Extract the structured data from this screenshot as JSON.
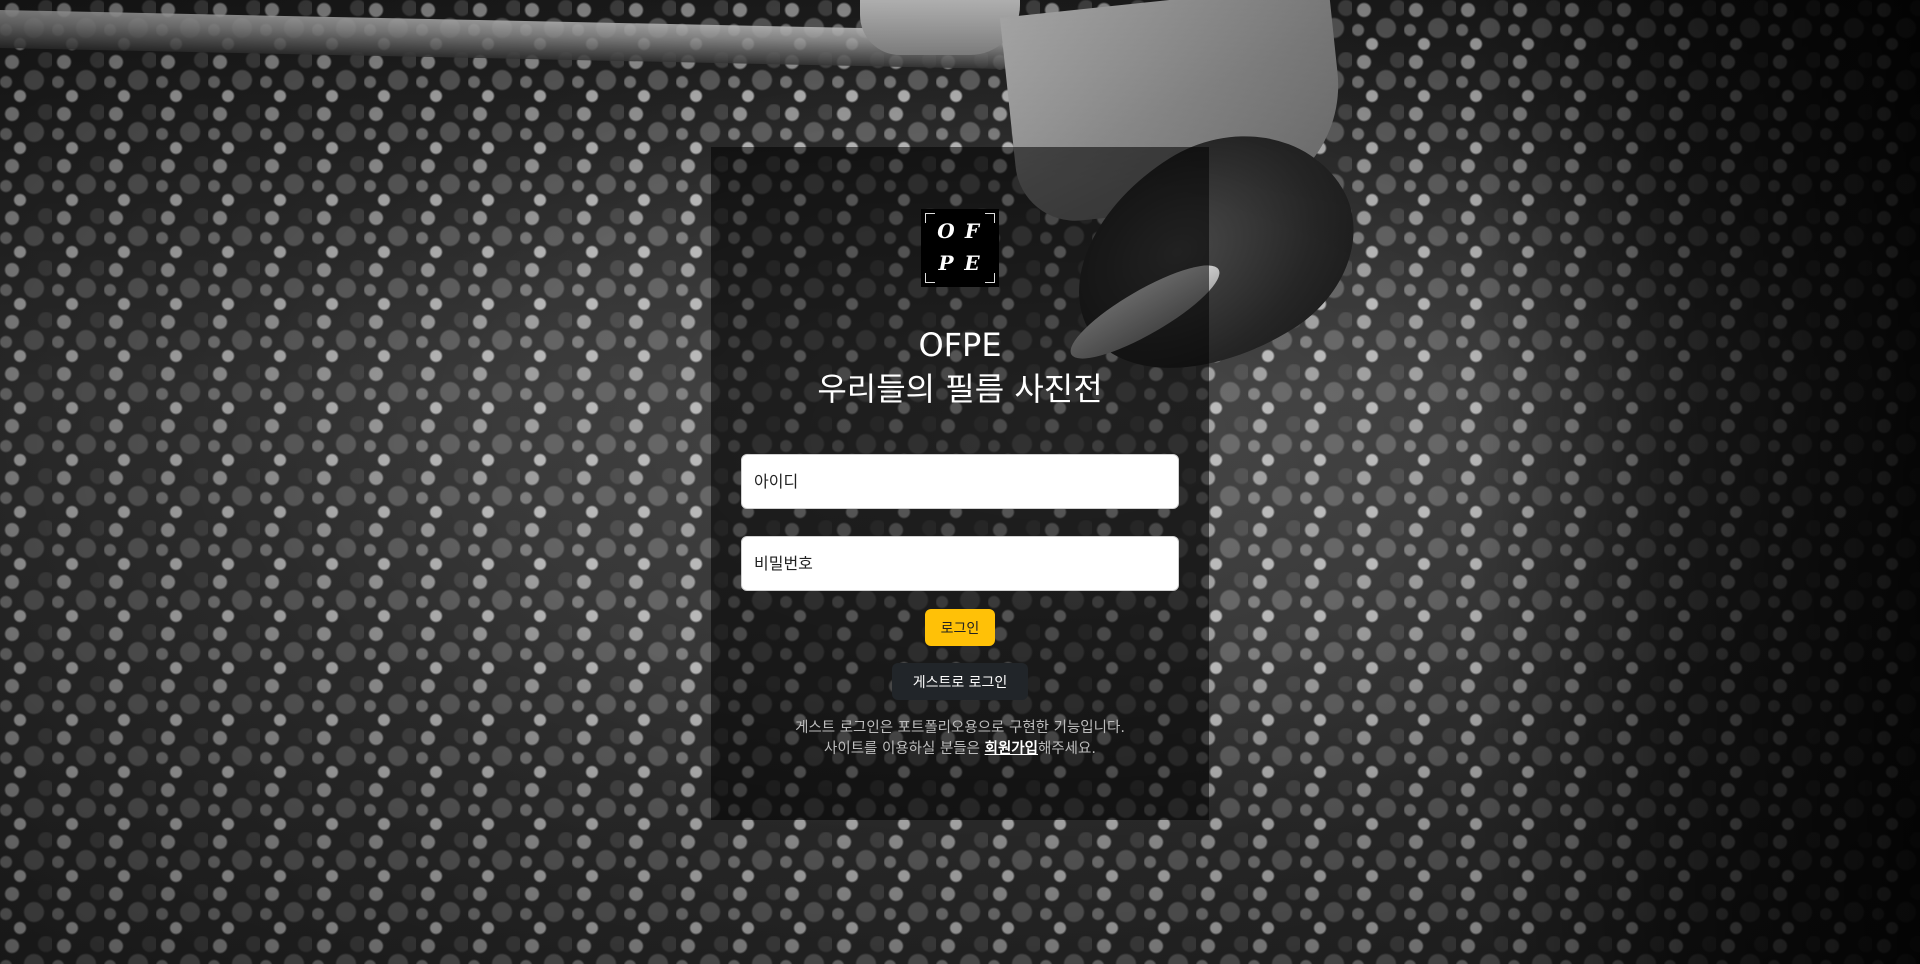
{
  "logo": {
    "letters": [
      "O",
      "F",
      "P",
      "E"
    ]
  },
  "title": {
    "line1": "OFPE",
    "line2": "우리들의 필름 사진전"
  },
  "form": {
    "id_placeholder": "아이디",
    "password_placeholder": "비밀번호",
    "login_label": "로그인",
    "guest_login_label": "게스트로 로그인"
  },
  "notice": {
    "line1": "게스트 로그인은 포트폴리오용으로 구현한 기능입니다.",
    "line2_prefix": "사이트를 이용하실 분들은 ",
    "signup_link": "회원가입",
    "line2_suffix": "해주세요."
  },
  "colors": {
    "login_button": "#ffc107",
    "guest_button": "#212529",
    "panel_overlay": "rgba(0,0,0,0.55)"
  }
}
